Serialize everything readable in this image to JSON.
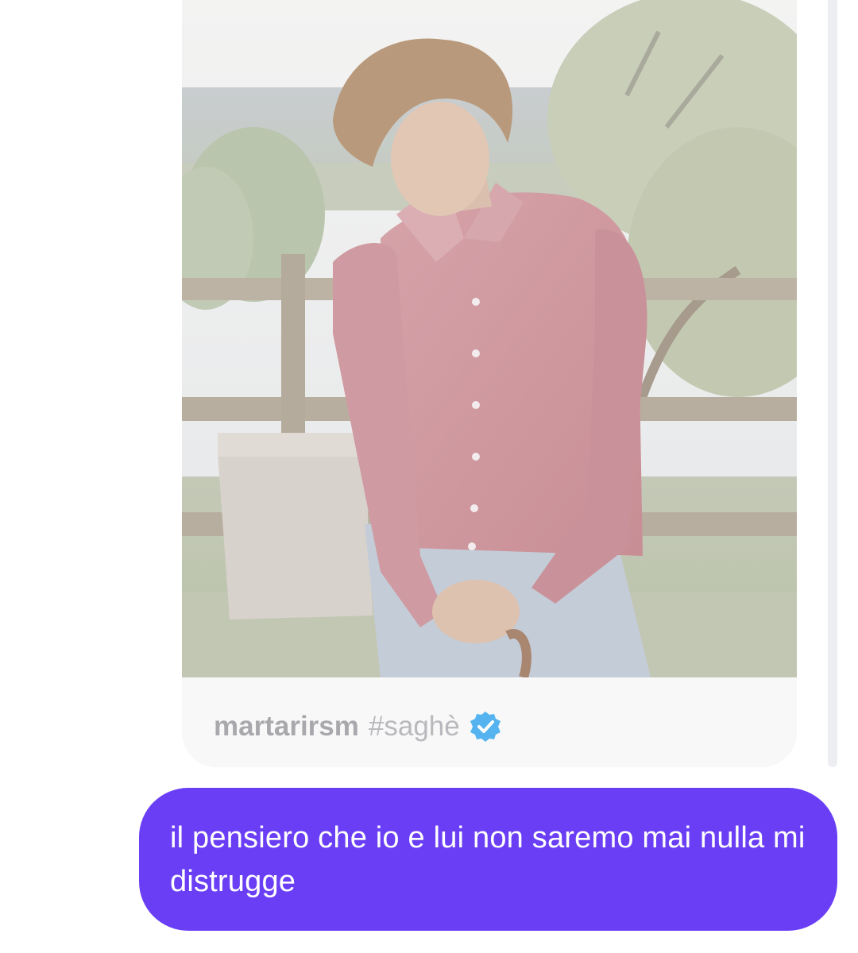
{
  "shared_post": {
    "username": "martarirsm",
    "hashtag": "#saghè",
    "verified_icon": "verified-badge-icon",
    "image_description_icon": "shared-photo"
  },
  "message": {
    "text": "il pensiero che io e lui non saremo mai nulla mi distrugge",
    "bubble_color": "#6a3ef5",
    "text_color": "#ffffff"
  },
  "colors": {
    "footer_text": "#b4b4b8",
    "verified_blue": "#55b4f0"
  }
}
